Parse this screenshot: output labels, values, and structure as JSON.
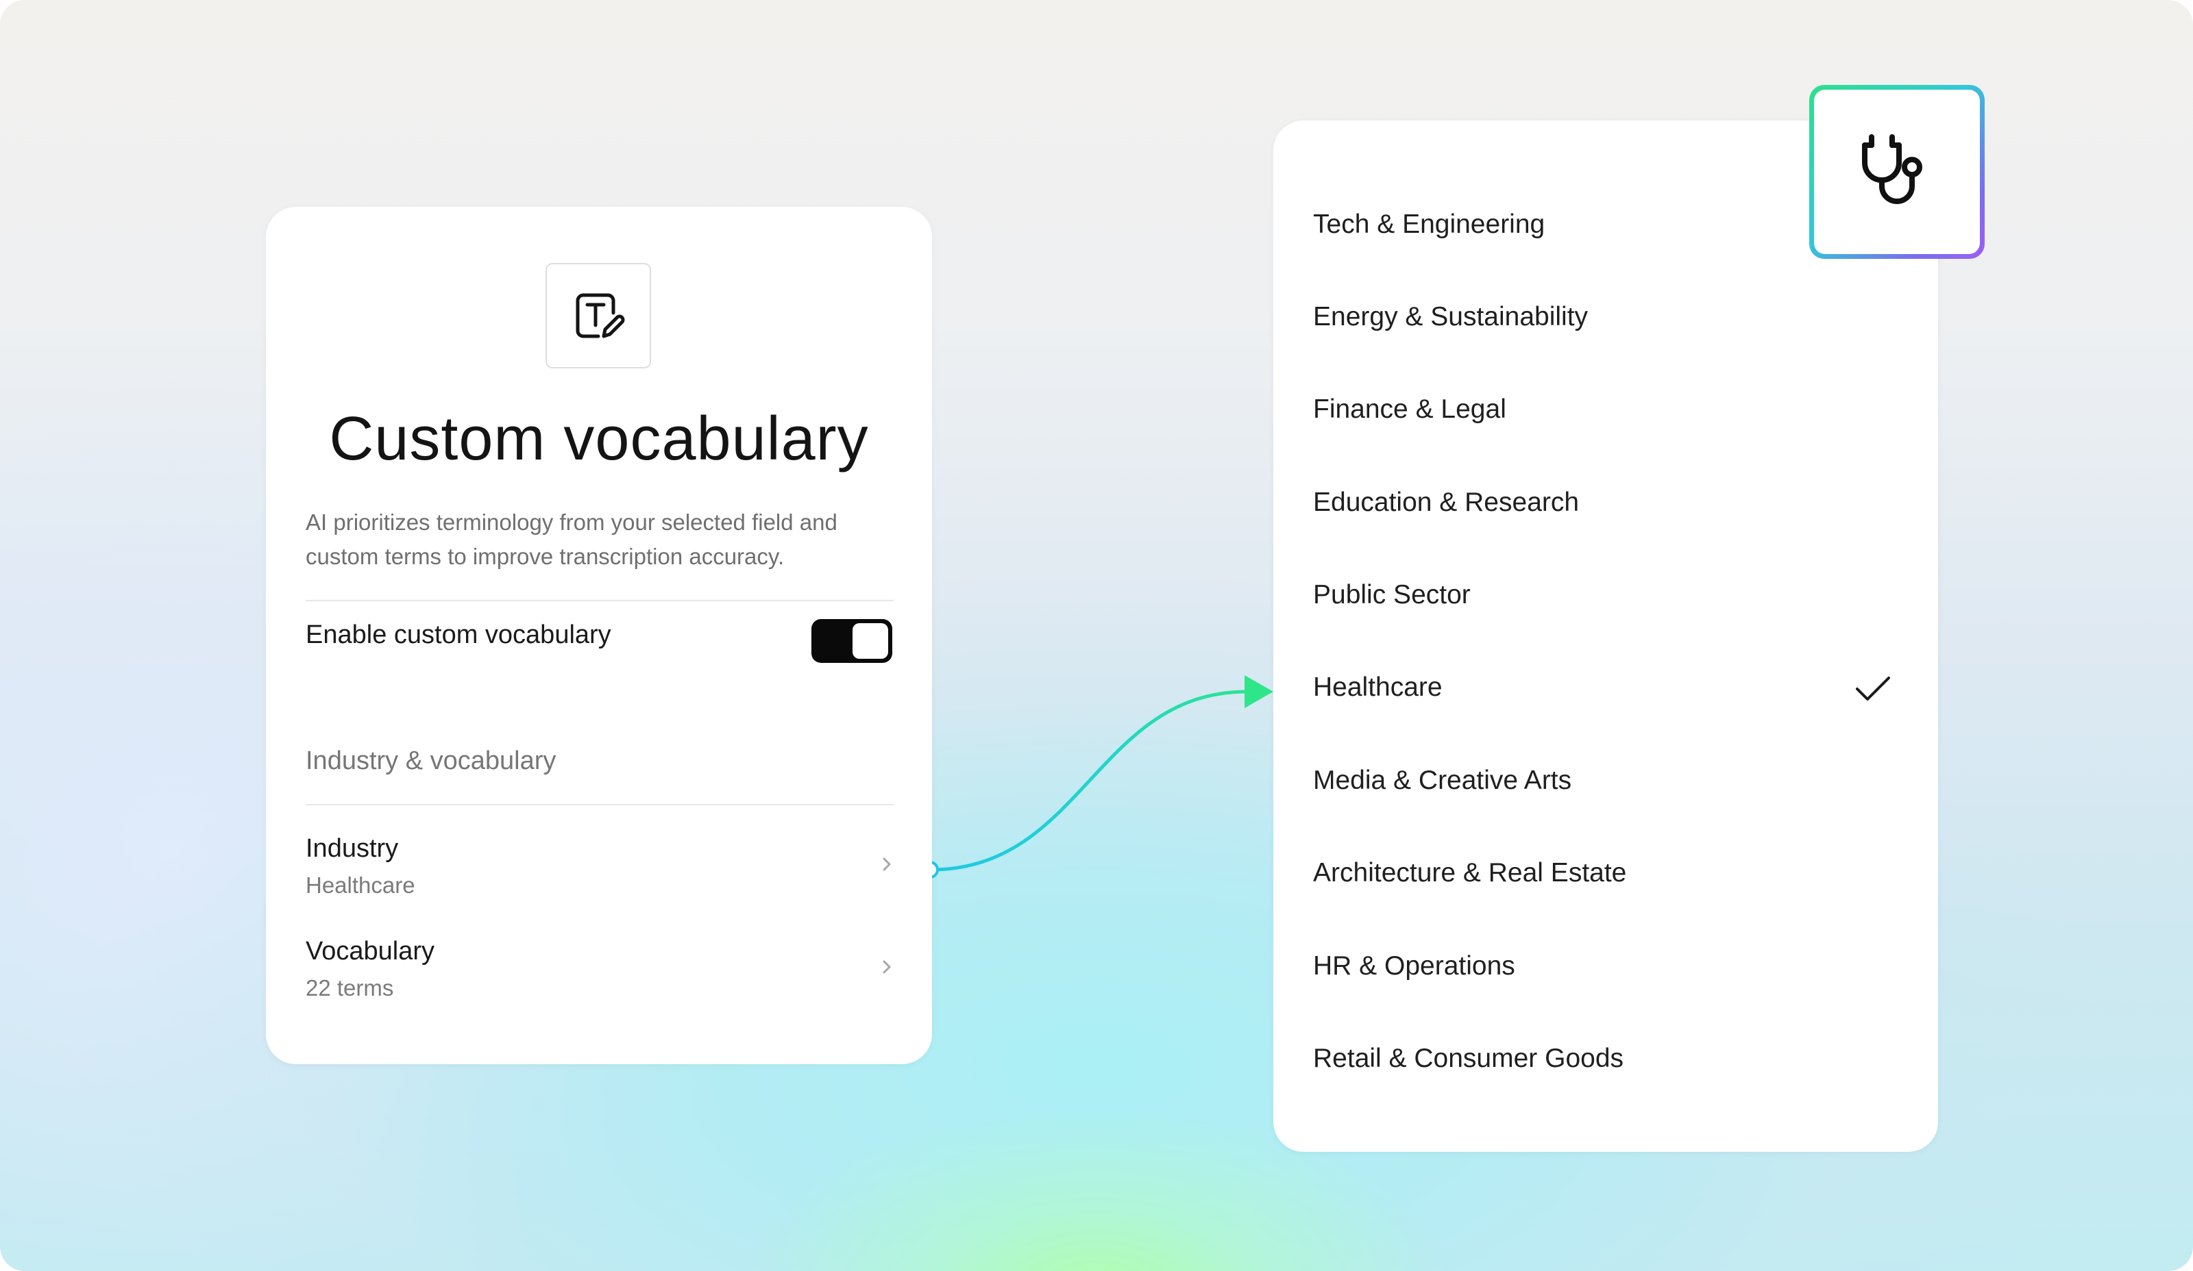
{
  "custom_vocabulary": {
    "icon": "text-edit-icon",
    "title": "Custom vocabulary",
    "description": "AI prioritizes terminology from your selected field and custom terms to improve transcription accuracy.",
    "toggle_label": "Enable custom vocabulary",
    "toggle_on": true,
    "section_header": "Industry & vocabulary",
    "rows": [
      {
        "title": "Industry",
        "subtitle": "Healthcare"
      },
      {
        "title": "Vocabulary",
        "subtitle": "22 terms"
      }
    ]
  },
  "industry_list": {
    "items": [
      "Tech & Engineering",
      "Energy & Sustainability",
      "Finance & Legal",
      "Education & Research",
      "Public Sector",
      "Healthcare",
      "Media & Creative Arts",
      "Architecture & Real Estate",
      "HR & Operations",
      "Retail & Consumer Goods"
    ],
    "selected": "Healthcare",
    "selected_icon": "stethoscope-icon"
  },
  "colors": {
    "connector_start": "#1fc8e6",
    "connector_end": "#2ee58a",
    "badge_gradient": [
      "#2fe08a",
      "#32c8d8",
      "#9d5ff2"
    ],
    "toggle_on": "#0a0a0a"
  }
}
